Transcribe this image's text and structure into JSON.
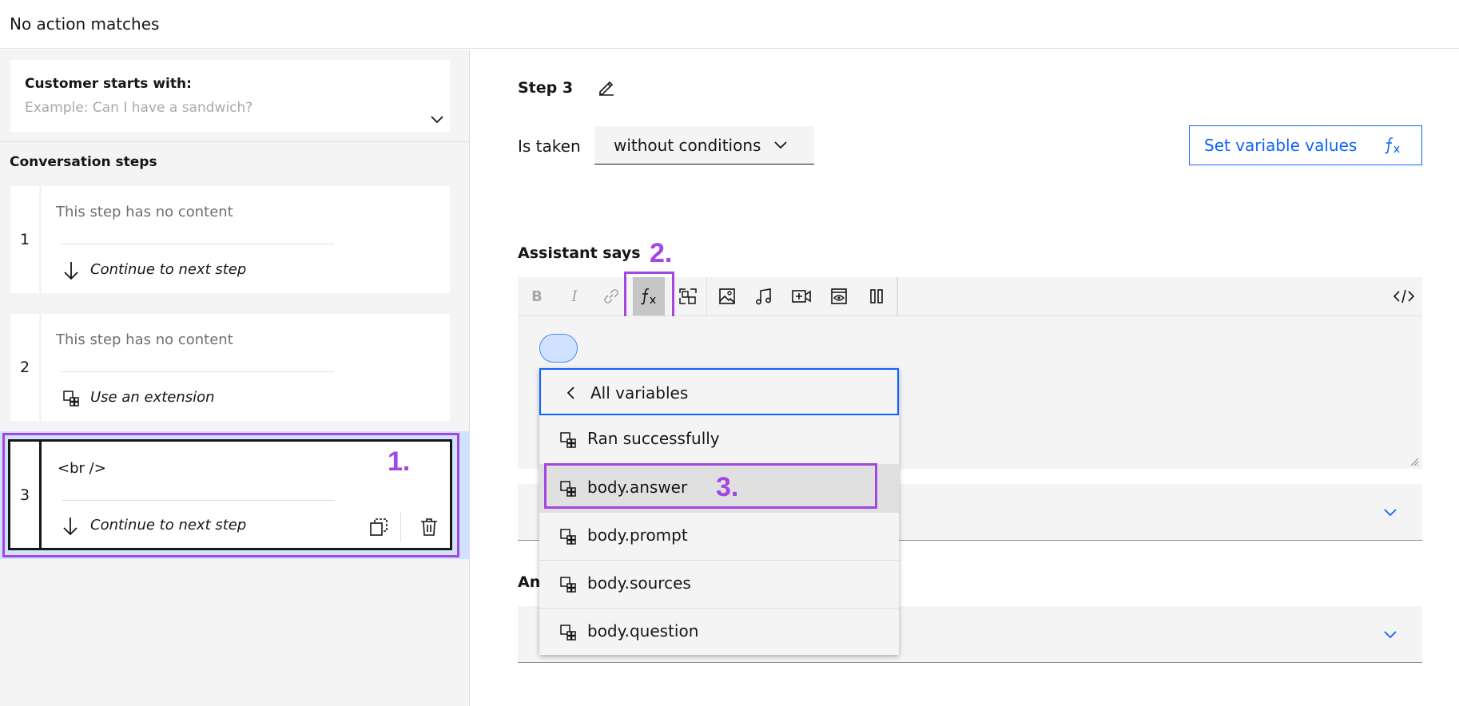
{
  "topbar": {
    "title": "No action matches"
  },
  "customer_starts": {
    "label": "Customer starts with:",
    "placeholder": "Example: Can I have a sandwich?"
  },
  "steps_section": {
    "title": "Conversation steps"
  },
  "steps": [
    {
      "number": "1",
      "content": "This step has no content",
      "action": "Continue to next step",
      "action_icon": "arrow-down-icon"
    },
    {
      "number": "2",
      "content": "This step has no content",
      "action": "Use an extension",
      "action_icon": "extension-icon"
    },
    {
      "number": "3",
      "content": "<br />",
      "action": "Continue to next step",
      "action_icon": "arrow-down-icon"
    }
  ],
  "step_editor": {
    "title": "Step 3",
    "is_taken_label": "Is taken",
    "condition_value": "without conditions",
    "set_variable_label": "Set variable values",
    "assistant_says_label": "Assistant says",
    "and_then_partial": "An"
  },
  "toolbar": {
    "buttons": [
      "bold",
      "italic",
      "link",
      "function",
      "variable-mapping",
      "image",
      "audio",
      "video",
      "iframe",
      "columns",
      "code"
    ]
  },
  "variable_menu": {
    "back_label": "All variables",
    "items": [
      "Ran successfully",
      "body.answer",
      "body.prompt",
      "body.sources",
      "body.question"
    ],
    "highlighted_index": 1
  },
  "annotations": [
    "1.",
    "2.",
    "3."
  ],
  "colors": {
    "accent": "#0f62fe",
    "annotation": "#a347e0",
    "pill": "#d0e2ff"
  }
}
